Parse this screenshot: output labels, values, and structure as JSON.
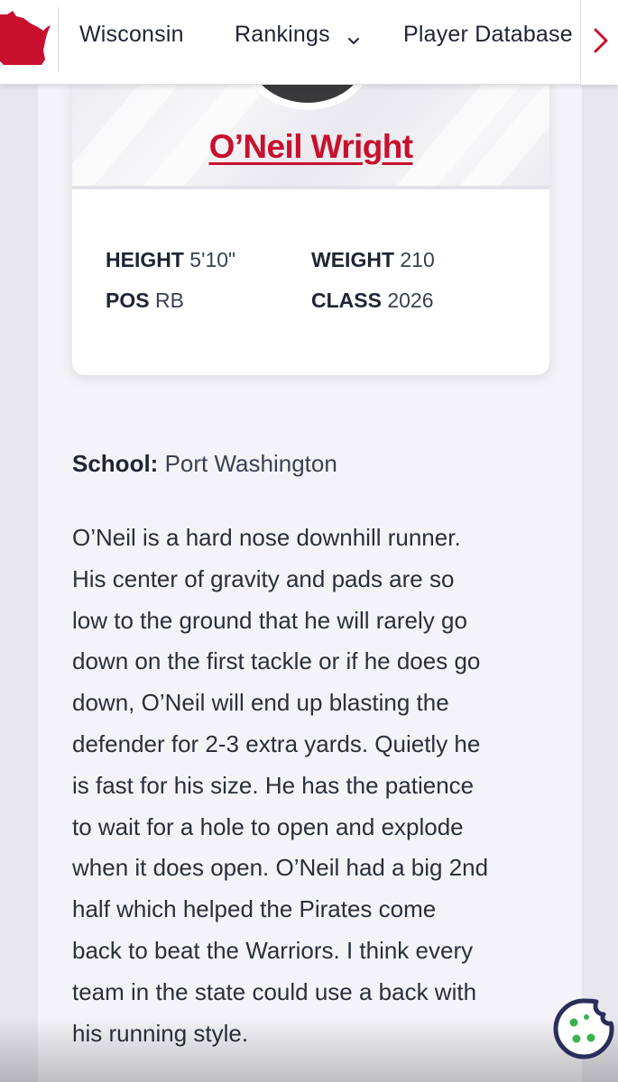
{
  "nav": {
    "items": [
      {
        "label": "Wisconsin"
      },
      {
        "label": "Rankings"
      },
      {
        "label": "Player Database"
      }
    ],
    "brand_color": "#c8102e"
  },
  "player": {
    "name": "O’Neil Wright",
    "stats": {
      "height_label": "HEIGHT",
      "height_value": "5'10\"",
      "weight_label": "WEIGHT",
      "weight_value": "210",
      "pos_label": "POS",
      "pos_value": "RB",
      "class_label": "CLASS",
      "class_value": "2026"
    },
    "school_label": "School:",
    "school_value": "Port Washington",
    "bio_lines": [
      "O’Neil is a hard nose downhill runner.",
      "His center of gravity and pads are so",
      "low to the ground that he will rarely go",
      "down on the first tackle or if he does go",
      "down, O’Neil will end up blasting the",
      "defender for 2-3 extra yards. Quietly he",
      "is fast for his size. He has the patience",
      "to wait for a hole to open and explode",
      "when it does open. O’Neil had a big 2nd",
      "half which helped the Pirates come",
      "back to beat the Warriors. I think every",
      "team in the state could use a back with",
      "his running style."
    ]
  },
  "icons": {
    "state_logo": "wisconsin-state-icon",
    "rankings_dropdown": "chevron-down-icon",
    "nav_next": "chevron-right-icon",
    "cookie": "cookie-icon"
  }
}
